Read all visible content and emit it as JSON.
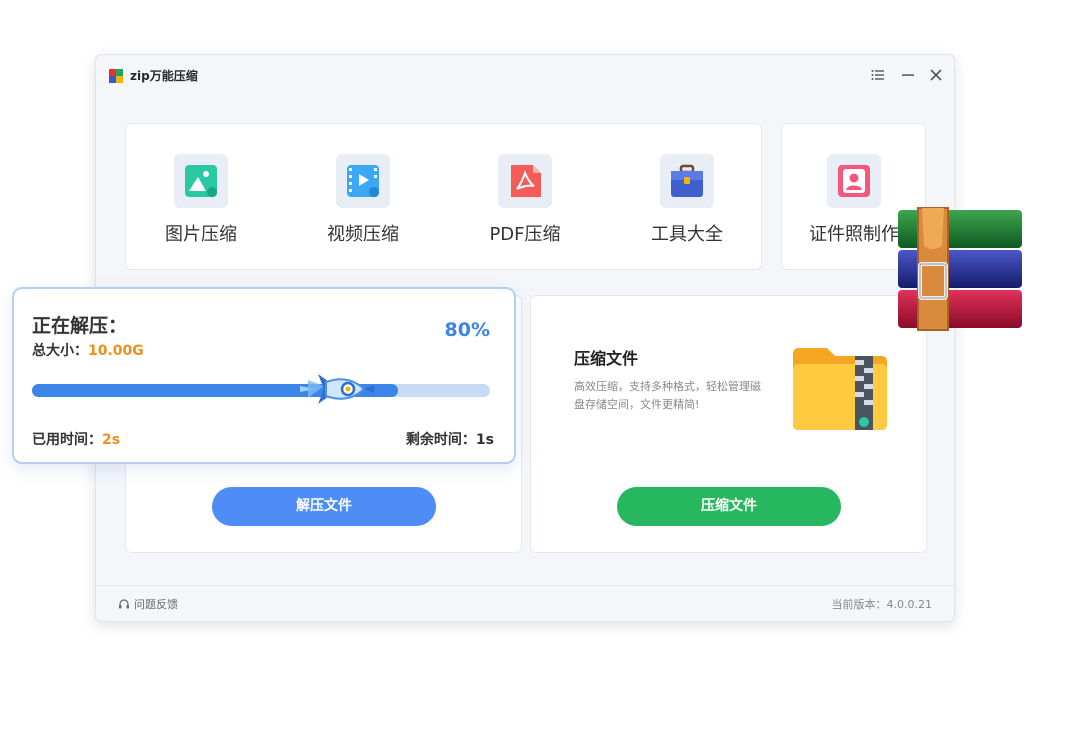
{
  "app": {
    "title": "zip万能压缩"
  },
  "window_controls": [
    "menu-icon",
    "minimize-icon",
    "close-icon"
  ],
  "tools": [
    {
      "label": "图片压缩",
      "icon": "image-compress-icon",
      "color": "#2bc9a3"
    },
    {
      "label": "视频压缩",
      "icon": "video-compress-icon",
      "color": "#3aa8f5"
    },
    {
      "label": "PDF压缩",
      "icon": "pdf-compress-icon",
      "color": "#f55b57"
    },
    {
      "label": "工具大全",
      "icon": "toolbox-icon",
      "color": "#3f5fcf"
    },
    {
      "label": "证件照制作",
      "icon": "id-photo-icon",
      "color": "#f2577e"
    }
  ],
  "extract": {
    "button_label": "解压文件",
    "color": "#4d8df5"
  },
  "compress": {
    "title": "压缩文件",
    "description": "高效压缩，支持多种格式，轻松管理磁盘存储空间，文件更精简!",
    "button_label": "压缩文件",
    "color": "#27b75e"
  },
  "progress": {
    "title": "正在解压：",
    "size_label": "总大小：",
    "size_value": "10.00G",
    "percent_text": "80%",
    "fill_percent": 80,
    "used_label": "已用时间：",
    "used_value": "2s",
    "remaining_label": "剩余时间：",
    "remaining_value": "1s"
  },
  "footer": {
    "feedback": "问题反馈",
    "version": "当前版本：4.0.0.21"
  }
}
